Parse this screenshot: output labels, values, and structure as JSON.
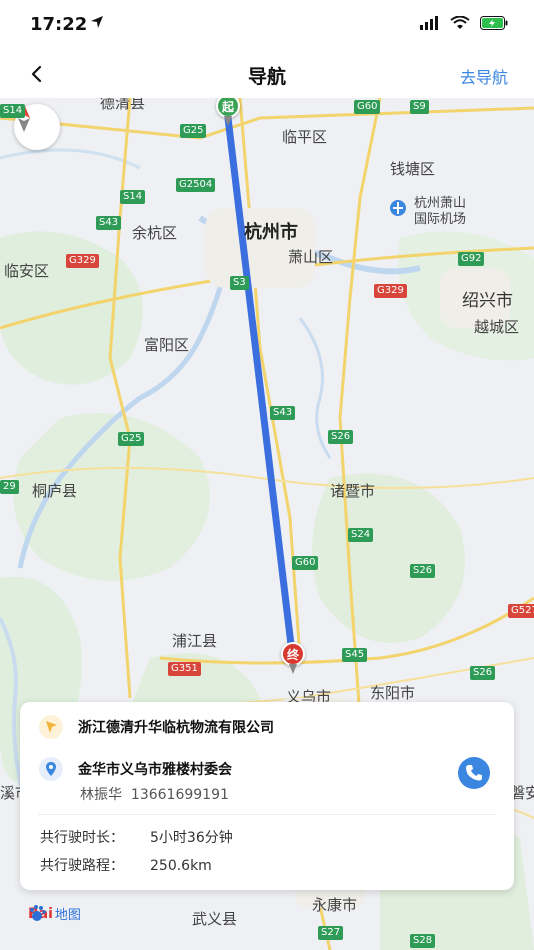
{
  "status_bar": {
    "time": "17:22"
  },
  "nav": {
    "title": "导航",
    "action": "去导航"
  },
  "map": {
    "cities": [
      {
        "id": "deqing",
        "name": "德清县"
      },
      {
        "id": "linping",
        "name": "临平区"
      },
      {
        "id": "qiantang",
        "name": "钱塘区"
      },
      {
        "id": "hangzhou",
        "name": "杭州市"
      },
      {
        "id": "airport1",
        "name": "杭州萧山"
      },
      {
        "id": "airport2",
        "name": "国际机场"
      },
      {
        "id": "yuhang",
        "name": "余杭区"
      },
      {
        "id": "xiaoshan",
        "name": "萧山区"
      },
      {
        "id": "linan",
        "name": "临安区"
      },
      {
        "id": "shaoxing",
        "name": "绍兴市"
      },
      {
        "id": "yuecheng",
        "name": "越城区"
      },
      {
        "id": "fuyang",
        "name": "富阳区"
      },
      {
        "id": "zhuji",
        "name": "诸暨市"
      },
      {
        "id": "tonglu",
        "name": "桐庐县"
      },
      {
        "id": "pujiang",
        "name": "浦江县"
      },
      {
        "id": "yiwu",
        "name": "义乌市"
      },
      {
        "id": "dongyang",
        "name": "东阳市"
      },
      {
        "id": "yongkang",
        "name": "永康市"
      },
      {
        "id": "wuyi",
        "name": "武义县"
      },
      {
        "id": "lanxi",
        "name": "溪市"
      },
      {
        "id": "panan",
        "name": "磐安"
      }
    ],
    "roads": [
      {
        "id": "s14",
        "name": "S14"
      },
      {
        "id": "g25a",
        "name": "G25"
      },
      {
        "id": "g60a",
        "name": "G60"
      },
      {
        "id": "s9",
        "name": "S9"
      },
      {
        "id": "g2504",
        "name": "G2504"
      },
      {
        "id": "s14b",
        "name": "S14"
      },
      {
        "id": "s43a",
        "name": "S43"
      },
      {
        "id": "g329a",
        "name": "G329"
      },
      {
        "id": "s3",
        "name": "S3"
      },
      {
        "id": "g92",
        "name": "G92"
      },
      {
        "id": "g329b",
        "name": "G329"
      },
      {
        "id": "s43b",
        "name": "S43"
      },
      {
        "id": "s26a",
        "name": "S26"
      },
      {
        "id": "g25b",
        "name": "G25"
      },
      {
        "id": "s24",
        "name": "S24"
      },
      {
        "id": "g60b",
        "name": "G60"
      },
      {
        "id": "s26b",
        "name": "S26"
      },
      {
        "id": "g527",
        "name": "G527"
      },
      {
        "id": "s45",
        "name": "S45"
      },
      {
        "id": "g351",
        "name": "G351"
      },
      {
        "id": "s26c",
        "name": "S26"
      },
      {
        "id": "s27",
        "name": "S27"
      },
      {
        "id": "s28",
        "name": "S28"
      },
      {
        "id": "s29",
        "name": "29"
      }
    ],
    "start_marker": "起",
    "end_marker": "终",
    "logo_text": "Bai",
    "logo_map": "地图",
    "route_color": "#3b6fe0"
  },
  "card": {
    "origin": "浙江德清升华临杭物流有限公司",
    "destination": "金华市义乌市雅楼村委会",
    "contact_name": "林振华",
    "contact_phone": "13661699191",
    "duration_label": "共行驶时长：",
    "duration_value": "5小时36分钟",
    "distance_label": "共行驶路程：",
    "distance_value": "250.6km"
  }
}
